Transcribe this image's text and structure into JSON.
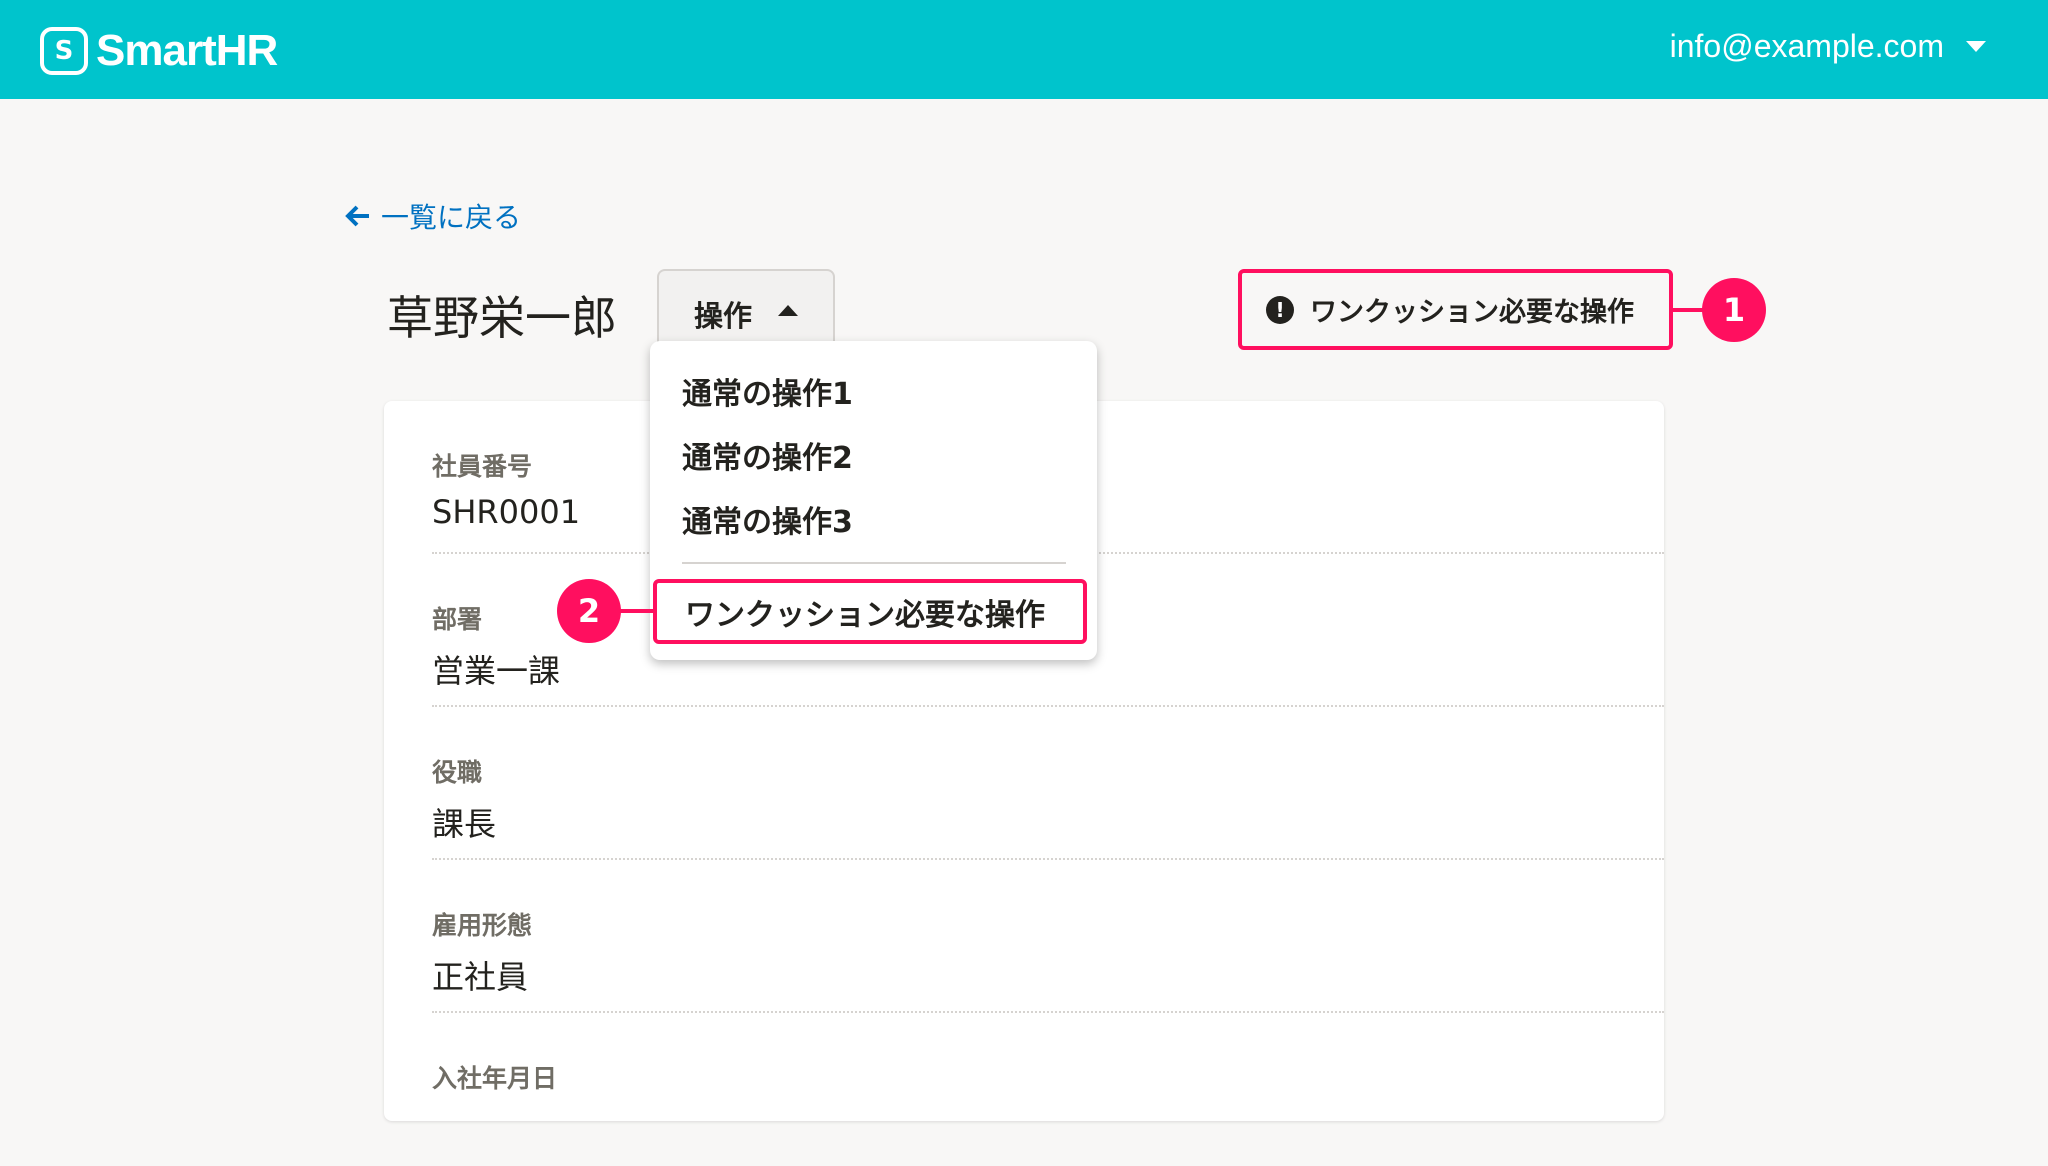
{
  "header": {
    "logo_text": "SmartHR",
    "logo_mark": "S",
    "account_email": "info@example.com",
    "accent": "#00c4cc"
  },
  "back_link": {
    "icon": "arrow-left-icon",
    "label": "一覧に戻る"
  },
  "employee_name": "草野栄一郎",
  "operations_button": {
    "label": "操作",
    "expanded": true
  },
  "menu": {
    "items": [
      "通常の操作1",
      "通常の操作2",
      "通常の操作3"
    ],
    "one_click_item": "ワンクッション必要な操作"
  },
  "warning_button": {
    "icon": "exclamation-circle-icon",
    "label": "ワンクッション必要な操作"
  },
  "annotations": {
    "badge1": "1",
    "badge2": "2",
    "color": "#ff0f5f"
  },
  "fields": [
    {
      "label": "社員番号",
      "value": "SHR0001"
    },
    {
      "label": "部署",
      "value": "営業一課"
    },
    {
      "label": "役職",
      "value": "課長"
    },
    {
      "label": "雇用形態",
      "value": "正社員"
    },
    {
      "label": "入社年月日",
      "value": ""
    }
  ]
}
